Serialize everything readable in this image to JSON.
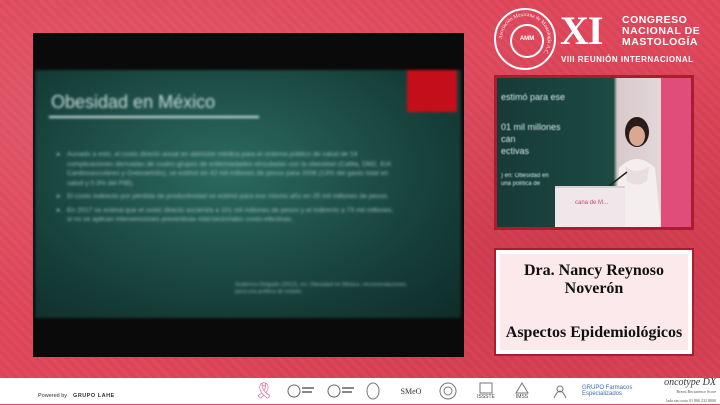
{
  "event": {
    "seal_text": "Asociación Mexicana de Mastología A.C.",
    "seal_abbr": "AMM",
    "roman": "XI",
    "congress_lines": [
      "CONGRESO",
      "NACIONAL DE",
      "MASTOLOGÍA"
    ],
    "subtitle": "VIII REUNIÓN INTERNACIONAL"
  },
  "slide": {
    "title": "Obesidad en México",
    "bullets": [
      "Aunado a esto, el costo directo anual en atención médica para el sistema público de salud de 14 complicaciones derivadas de cuatro grupos de enfermedades vinculadas con la obesidad (CaMa, DM2, Enf. Cardiovasculares y Osteoartritis), se estimó en 42 mil millones de pesos para 2008 (13% del gasto total en salud y 0.3% del PIB).",
      "El costo indirecto por pérdida de productividad se estimó para ese mismo año en 25 mil millones de pesos.",
      "En 2017 se estima que el costo directo ascienda a 101 mil millones de pesos y el indirecto a 73 mil millones, si no se aplican intervenciones preventivas intersectoriales costo-efectivas."
    ],
    "reference": "Gutiérrez-Delgado (2012), en: Obesidad en México, recomendaciones para una política de estado."
  },
  "camera": {
    "lines": [
      "estimó para ese",
      "01 mil millones",
      "can",
      "ectivas"
    ],
    "ref_lines": [
      ") en: Obesidad en",
      "una política de"
    ],
    "lectern_text": "cana de M..."
  },
  "speaker": {
    "name": "Dra. Nancy Reynoso Noverón",
    "topic": "Aspectos Epidemiológicos"
  },
  "footer": {
    "powered_label": "Powered by",
    "powered_brand": "GRUPO LAHE",
    "sponsors": [
      "SMeO",
      "ISSSTE",
      "IMSS",
      "GRUPO Farmacos Especializados",
      "oncotype DX"
    ],
    "oncotype_sub": "Breast Recurrence Score",
    "oncotype_phone": "lada sin costo 01 800 232 8000"
  },
  "colors": {
    "background": "#dd4458",
    "frame": "#a81d31",
    "slide": "#1c4a43",
    "slide_accent": "#c40f1a"
  }
}
